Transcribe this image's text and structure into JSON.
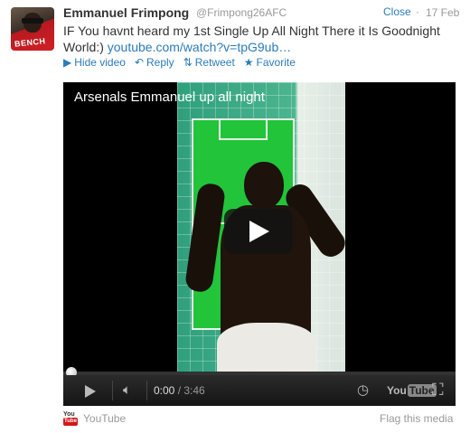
{
  "tweet": {
    "name": "Emmanuel Frimpong",
    "handle": "@Frimpong26AFC",
    "close_label": "Close",
    "dot": "·",
    "date": "17 Feb",
    "text": "IF You havnt heard my 1st Single Up All Night There it Is Goodnight World:) ",
    "link": "youtube.com/watch?v=tpG9ub…"
  },
  "avatar": {
    "shirt_text": "BENCH"
  },
  "actions": [
    {
      "label": "Hide video",
      "icon": "video-icon"
    },
    {
      "label": "Reply",
      "icon": "reply-icon"
    },
    {
      "label": "Retweet",
      "icon": "retweet-icon"
    },
    {
      "label": "Favorite",
      "icon": "star-icon"
    }
  ],
  "video": {
    "title": "Arsenals Emmanuel up all night",
    "current_time": "0:00",
    "duration": "/ 3:46",
    "progress": 0,
    "logo_you": "You",
    "logo_tube": "Tube"
  },
  "footer": {
    "source_label": "YouTube",
    "flag_label": "Flag this media",
    "mini_you": "You",
    "mini_tube": "Tube"
  },
  "colors": {
    "link": "#2b7bb9",
    "muted": "#999999",
    "youtube_red": "#d2181a"
  }
}
